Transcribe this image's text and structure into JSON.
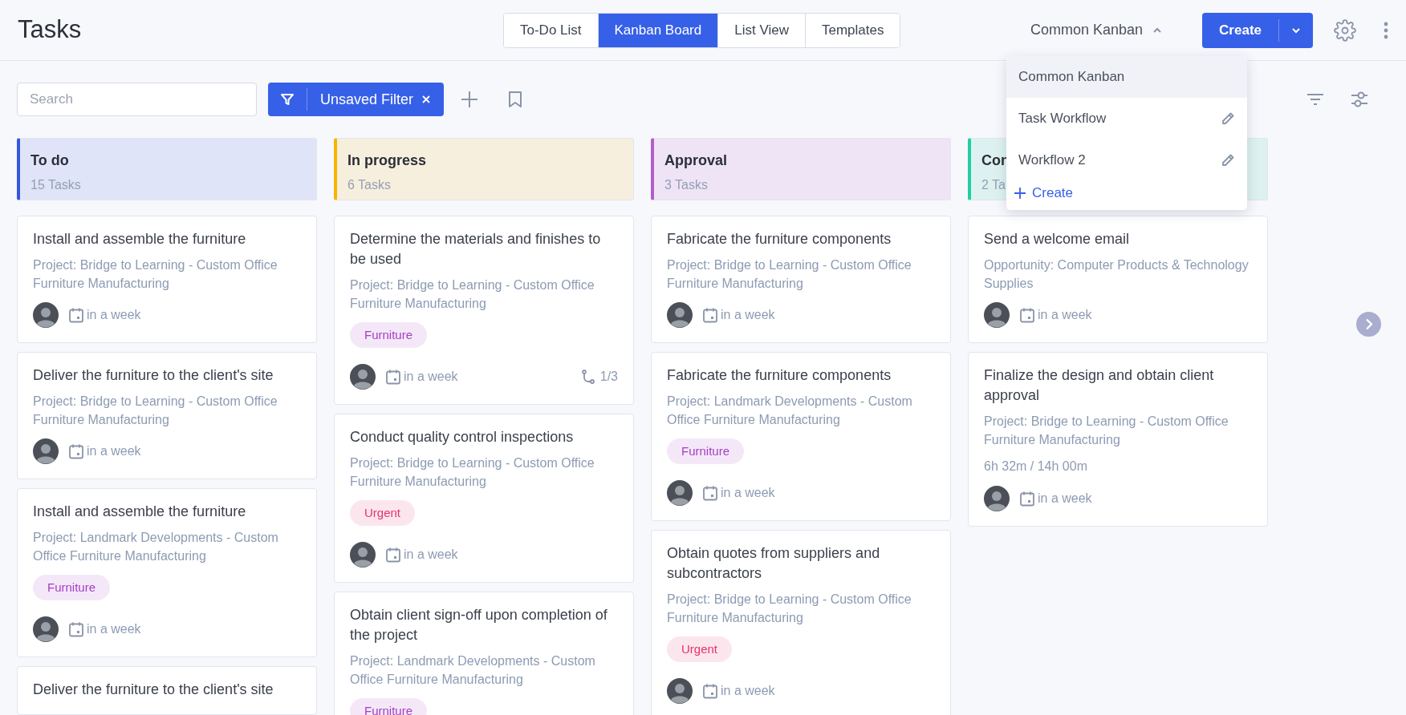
{
  "page_title": "Tasks",
  "view_tabs": [
    {
      "label": "To-Do List",
      "selected": false
    },
    {
      "label": "Kanban Board",
      "selected": true
    },
    {
      "label": "List View",
      "selected": false
    },
    {
      "label": "Templates",
      "selected": false
    }
  ],
  "board_selector": {
    "label": "Common Kanban",
    "expanded": true
  },
  "create_button": {
    "label": "Create"
  },
  "search": {
    "placeholder": "Search"
  },
  "filter": {
    "label": "Unsaved Filter"
  },
  "board_menu": {
    "items": [
      {
        "label": "Common Kanban",
        "selected": true,
        "editable": false
      },
      {
        "label": "Task Workflow",
        "selected": false,
        "editable": true
      },
      {
        "label": "Workflow 2",
        "selected": false,
        "editable": true
      }
    ],
    "create_label": "Create"
  },
  "columns": [
    {
      "title": "To do",
      "count": "15 Tasks",
      "color": "#3557e0",
      "cards": [
        {
          "title": "Install and assemble the furniture",
          "subtitle": "Project: Bridge to Learning - Custom Office Furniture Manufacturing",
          "due": "in a week"
        },
        {
          "title": "Deliver the furniture to the client's site",
          "subtitle": "Project: Bridge to Learning - Custom Office Furniture Manufacturing",
          "due": "in a week"
        },
        {
          "title": "Install and assemble the furniture",
          "subtitle": "Project: Landmark Developments - Custom Office Furniture Manufacturing",
          "tag": {
            "label": "Furniture",
            "color": "#a53fc2"
          },
          "due": "in a week"
        },
        {
          "title": "Deliver the furniture to the client's site"
        }
      ]
    },
    {
      "title": "In progress",
      "count": "6 Tasks",
      "color": "#f7b500",
      "cards": [
        {
          "title": "Determine the materials and finishes to be used",
          "subtitle": "Project: Bridge to Learning - Custom Office Furniture Manufacturing",
          "tag": {
            "label": "Furniture",
            "color": "#a53fc2"
          },
          "due": "in a week",
          "subtasks": "1/3"
        },
        {
          "title": "Conduct quality control inspections",
          "subtitle": "Project: Bridge to Learning - Custom Office Furniture Manufacturing",
          "tag": {
            "label": "Urgent",
            "color": "#e5336b"
          },
          "due": "in a week"
        },
        {
          "title": "Obtain client sign-off upon completion of the project",
          "subtitle": "Project: Landmark Developments - Custom Office Furniture Manufacturing",
          "tag": {
            "label": "Furniture",
            "color": "#a53fc2"
          }
        }
      ]
    },
    {
      "title": "Approval",
      "count": "3 Tasks",
      "color": "#b45ccb",
      "cards": [
        {
          "title": "Fabricate the furniture components",
          "subtitle": "Project: Bridge to Learning - Custom Office Furniture Manufacturing",
          "due": "in a week"
        },
        {
          "title": "Fabricate the furniture components",
          "subtitle": "Project: Landmark Developments - Custom Office Furniture Manufacturing",
          "tag": {
            "label": "Furniture",
            "color": "#a53fc2"
          },
          "due": "in a week"
        },
        {
          "title": "Obtain quotes from suppliers and subcontractors",
          "subtitle": "Project: Bridge to Learning - Custom Office Furniture Manufacturing",
          "tag": {
            "label": "Urgent",
            "color": "#e5336b"
          },
          "due": "in a week"
        }
      ]
    },
    {
      "title": "Con",
      "count": "2 Ta",
      "color": "#1fcfa0",
      "cards": [
        {
          "title": "Send a welcome email",
          "subtitle": "Opportunity: Computer Products & Technology Supplies",
          "due": "in a week"
        },
        {
          "title": "Finalize the design and obtain client approval",
          "subtitle": "Project: Bridge to Learning - Custom Office Furniture Manufacturing",
          "time_tracked": "6h 32m / 14h 00m",
          "due": "in a week"
        }
      ]
    }
  ]
}
